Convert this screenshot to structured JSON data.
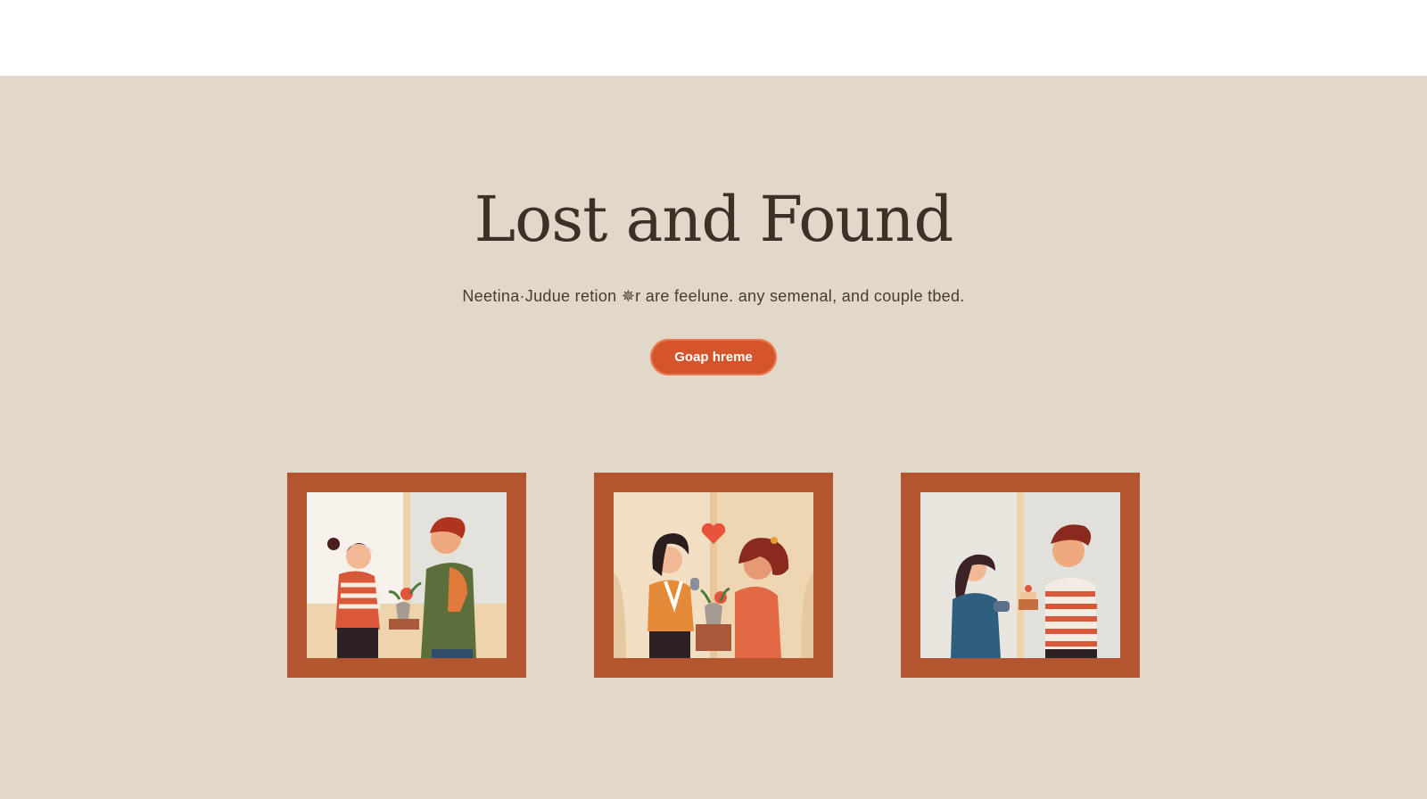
{
  "hero": {
    "title": "Lost and Found",
    "subtitle": "Neetina·Judue retion ✵r are feelune. any semenal, and couple tbed.",
    "cta_label": "Goap hreme"
  },
  "gallery": {
    "items": [
      {
        "name": "gallery-photo-plant-gift",
        "icon": "illustration-couple-plant"
      },
      {
        "name": "gallery-photo-heart-plant",
        "icon": "illustration-couple-heart"
      },
      {
        "name": "gallery-photo-cake-gift",
        "icon": "illustration-couple-cake"
      }
    ]
  },
  "colors": {
    "background": "#e2d8ca",
    "title": "#3e2f27",
    "accent": "#d4542c",
    "frame": "#b3562f"
  }
}
